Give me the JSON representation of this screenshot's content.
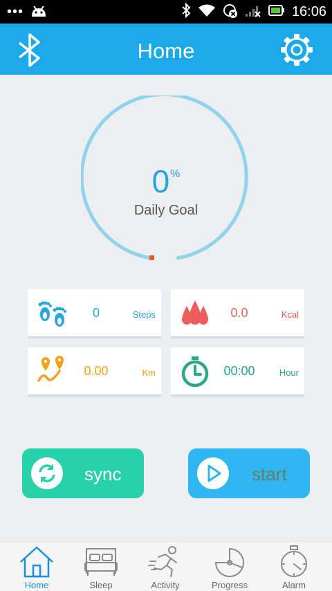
{
  "status_bar": {
    "dots": "•••",
    "time": "16:06"
  },
  "app_bar": {
    "title": "Home"
  },
  "goal": {
    "percent": "0",
    "percent_unit": "%",
    "label": "Daily Goal",
    "progress": 0
  },
  "stats": {
    "steps": {
      "value": "0",
      "unit": "Steps",
      "color": "#27a6de"
    },
    "kcal": {
      "value": "0.0",
      "unit": "Kcal",
      "color": "#ee5c5c"
    },
    "km": {
      "value": "0.00",
      "unit": "Km",
      "color": "#f3a21c"
    },
    "hour": {
      "value": "00:00",
      "unit": "Hour",
      "color": "#2aa887"
    }
  },
  "buttons": {
    "sync_label": "sync",
    "start_label": "start"
  },
  "tabs": [
    {
      "label": "Home",
      "icon": "home-icon"
    },
    {
      "label": "Sleep",
      "icon": "bed-icon"
    },
    {
      "label": "Activity",
      "icon": "runner-icon"
    },
    {
      "label": "Progress",
      "icon": "pie-chart-icon"
    },
    {
      "label": "Alarm",
      "icon": "stopwatch-icon"
    }
  ],
  "colors": {
    "accent": "#1ba9ea",
    "ring": "#8fd3ec",
    "sync": "#27d2ab",
    "start": "#30b6f0",
    "ring_marker": "#f05a22"
  }
}
